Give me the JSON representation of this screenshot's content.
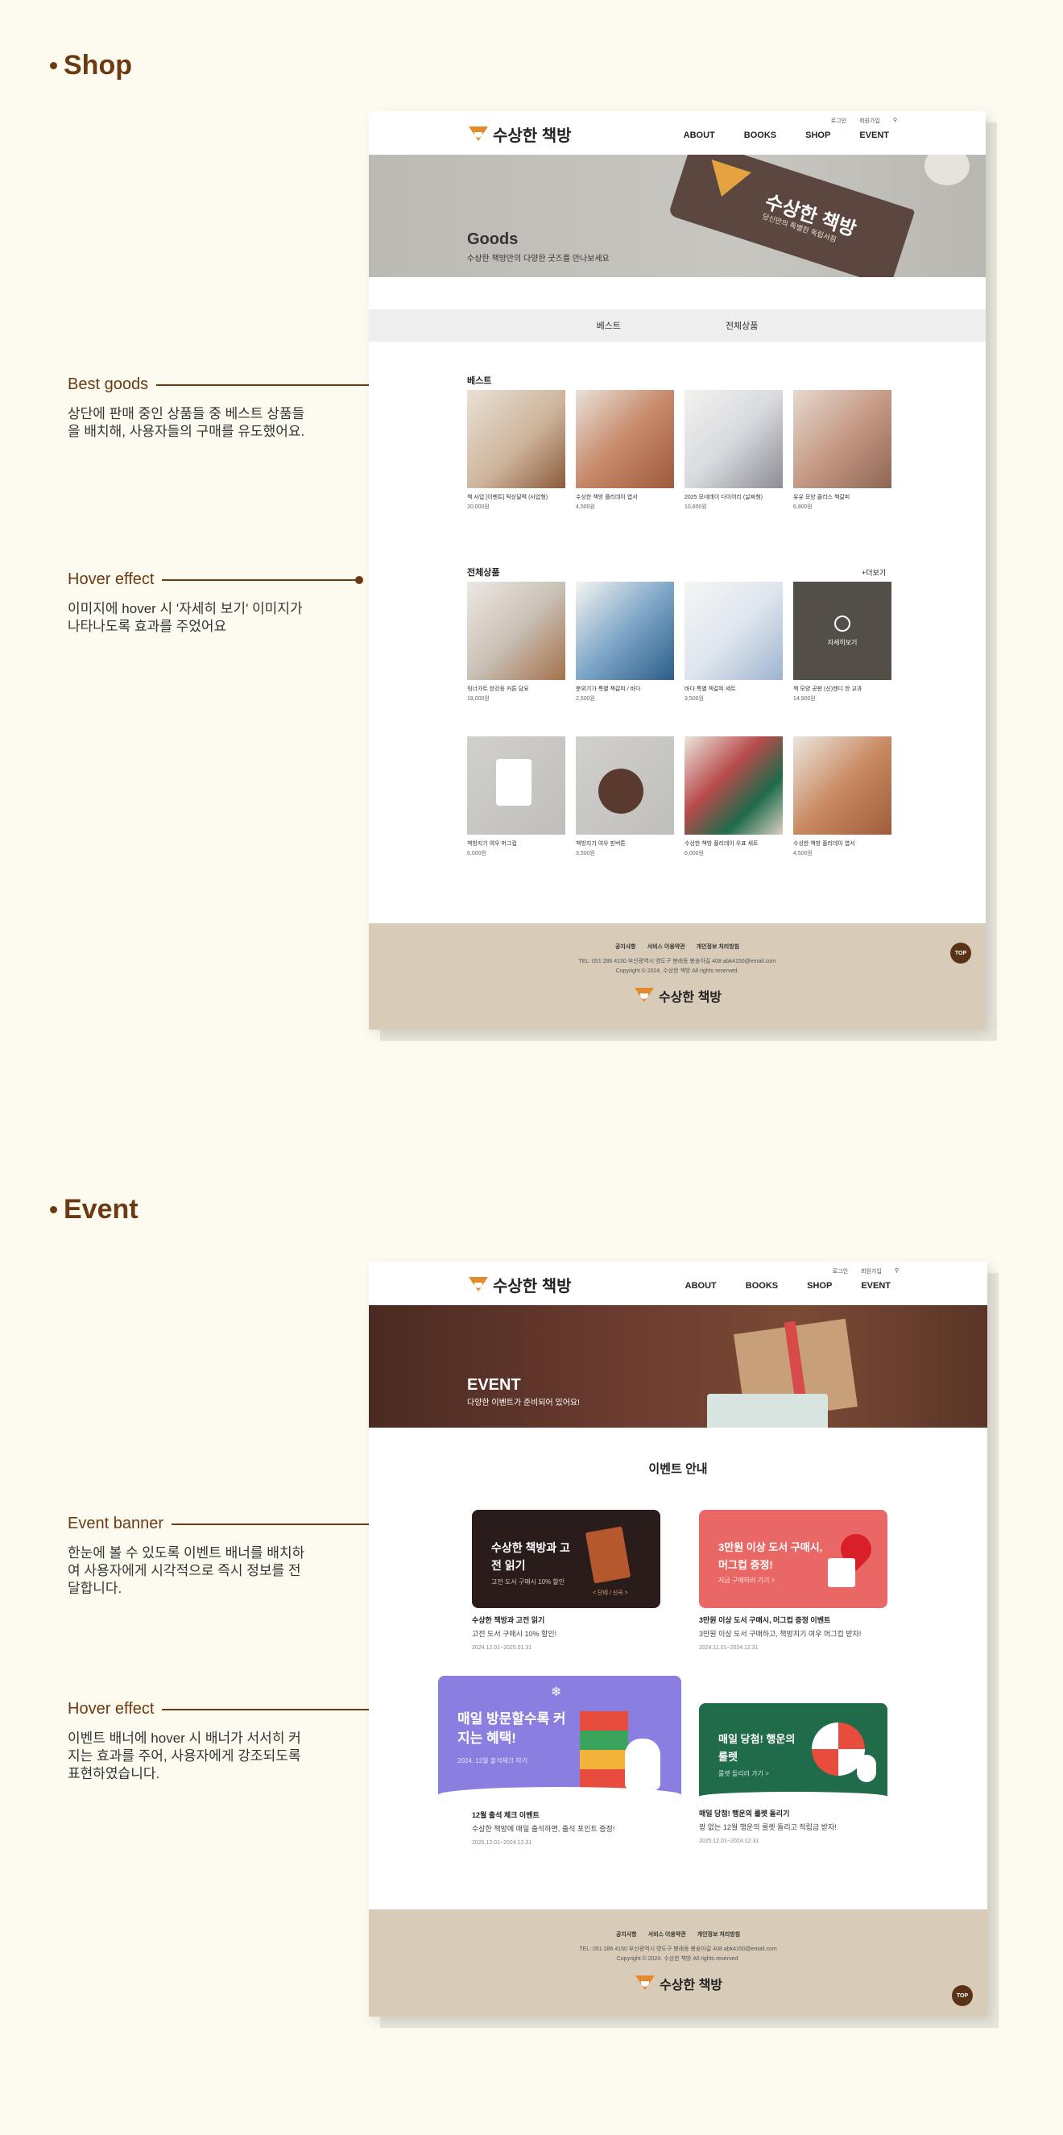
{
  "shop_section": {
    "title": "Shop"
  },
  "event_section": {
    "title": "Event"
  },
  "annotations": {
    "best_goods": {
      "label": "Best goods",
      "desc": "상단에 판매 중인 상품들 중 베스트 상품들을 배치해, 사용자들의 구매를 유도했어요."
    },
    "hover_effect_shop": {
      "label": "Hover effect",
      "desc": "이미지에 hover 시 '자세히 보기' 이미지가 나타나도록 효과를 주었어요"
    },
    "event_banner": {
      "label": "Event banner",
      "desc": "한눈에 볼 수 있도록 이벤트 배너를 배치하여 사용자에게 시각적으로 즉시 정보를 전달합니다."
    },
    "hover_effect_event": {
      "label": "Hover effect",
      "desc": "이벤트 배너에 hover 시 배너가 서서히 커지는 효과를 주어, 사용자에게 강조되도록 표현하였습니다."
    }
  },
  "header": {
    "logo_text": "수상한 책방",
    "login": "로그인",
    "signup": "회원가입",
    "nav": [
      "ABOUT",
      "BOOKS",
      "SHOP",
      "EVENT"
    ]
  },
  "shop_page": {
    "hero_title": "Goods",
    "hero_sub": "수상한 책방만의 다양한 굿즈를 만나보세요",
    "tag_text": "수상한 책방",
    "tag_sub": "당신만의 특별한 독립서점",
    "tabs": [
      "베스트",
      "전체상품"
    ],
    "best_heading": "베스트",
    "all_heading": "전체상품",
    "more": "+더보기",
    "best": [
      {
        "name": "책 사업 [이벤트] 탁상달력 (사업형)",
        "price": "20,000원"
      },
      {
        "name": "수상한 책방 플리데이 엽서",
        "price": "4,500원"
      },
      {
        "name": "2025 모네데이 다이어리 (날짜형)",
        "price": "10,800원"
      },
      {
        "name": "유유 모양 클리스 책갈피",
        "price": "6,800원"
      }
    ],
    "all": [
      {
        "name": "워너가트 한강등 커튼 담요",
        "price": "18,000원"
      },
      {
        "name": "분위기가 특별 책갈피 / 바다",
        "price": "2,500원"
      },
      {
        "name": "바다 특별 책갈피 세트",
        "price": "3,500원"
      },
      {
        "name": "책 모양 공판 (신)헨디 한 교과",
        "price": "14,900원"
      },
      {
        "name": "책방지기 여우 머그컵",
        "price": "6,000원"
      },
      {
        "name": "책방지기 여우 핀버튼",
        "price": "3,500원"
      },
      {
        "name": "수상한 책방 플리데이 우표 세트",
        "price": "6,000원"
      },
      {
        "name": "수상한 책방 플리데이 엽서",
        "price": "4,500원"
      }
    ],
    "hover_label": "자세히보기"
  },
  "event_page": {
    "hero_title": "EVENT",
    "hero_sub": "다양한 이벤트가 준비되어 있어요!",
    "section_title": "이벤트 안내",
    "events": [
      {
        "banner_title": "수상한 책방과 고전 읽기",
        "banner_sub": "고전 도서 구매시 10% 할인",
        "banner_extra": "< 단테 / 신곡 >",
        "title": "수상한 책방과 고전 읽기",
        "desc": "고전 도서 구매시 10% 할인!",
        "date": "2024.12.01~2025.01.31"
      },
      {
        "banner_title": "3만원 이상 도서 구매시, 머그컵 증정!",
        "banner_sub": "지금 구매하러 가기 >",
        "title": "3만원 이상 도서 구매시, 머그컵 증정 이벤트",
        "desc": "3만원 이상 도서 구매하고, 책방지기 여우 머그컵 받자!",
        "date": "2024.11.01~2024.12.31"
      },
      {
        "banner_title": "매일 방문할수록 커지는 혜택!",
        "banner_sub": "2024. 12월 출석체크 하기",
        "title": "12월 출석 체크 이벤트",
        "desc": "수상한 책방에 매일 출석하면, 출석 포인트 증정!",
        "date": "2025.12.01~2024.12.31"
      },
      {
        "banner_title": "매일 당첨! 행운의 룰렛",
        "banner_sub": "룰렛 돌리러 가기 >",
        "title": "매일 당첨! 행운의 룰렛 돌리기",
        "desc": "꽝 없는 12월 행운의 룰렛 돌리고 적립금 받자!",
        "date": "2025.12.01~2024.12.31"
      }
    ]
  },
  "footer": {
    "links": [
      "공지사항",
      "서비스 이용약관",
      "개인정보 처리방침"
    ],
    "info": "TEL: 051 286 4150    부산광역시 영도구 봉래동 봉숭아길 408    abk4150@email.com",
    "copyright": "Copyright © 2024. 수상한 책방 All rights reserved.",
    "logo_text": "수상한 책방",
    "top": "TOP"
  },
  "colors": {
    "accent": "#6b3a12",
    "page_bg": "#fdfbf0",
    "footer_bg": "#d8cbb8",
    "event_red": "#e96866",
    "event_purple": "#8a7fe0",
    "event_green": "#1f6b4a",
    "event_dark": "#2b1c1c"
  }
}
